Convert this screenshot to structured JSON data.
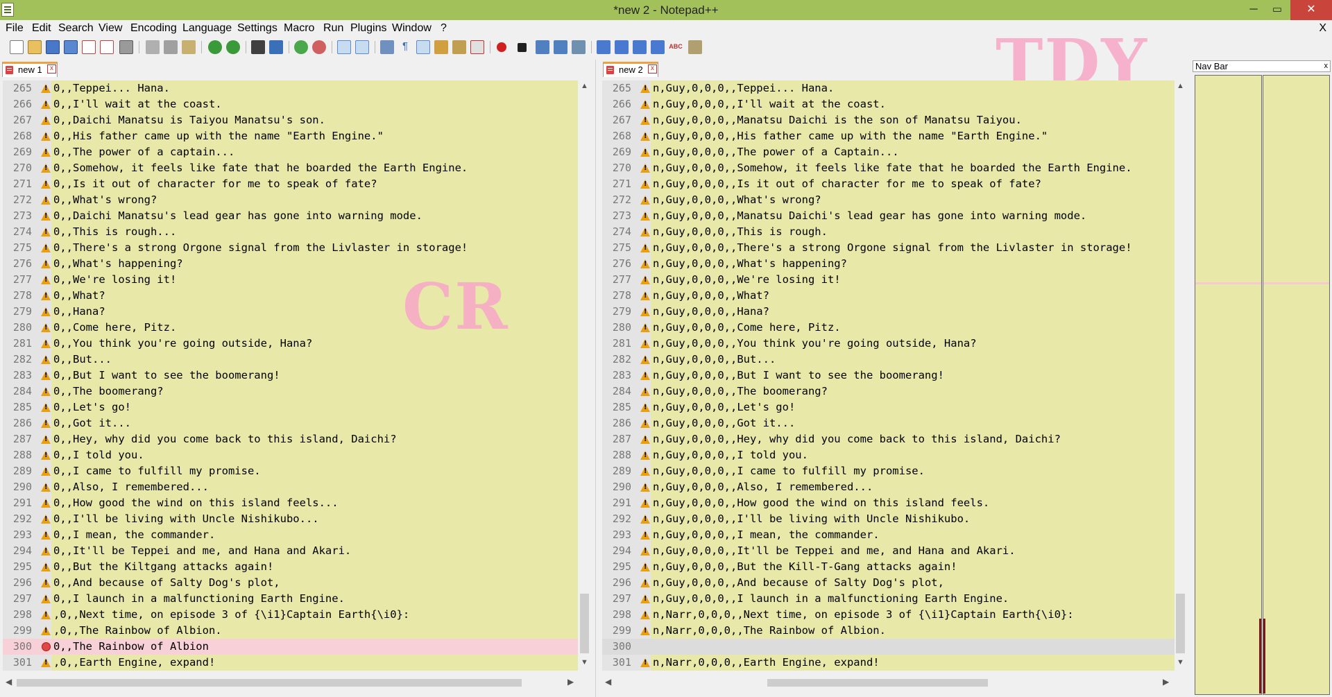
{
  "window": {
    "title": "*new  2 - Notepad++",
    "minimize": "─",
    "maximize": "▭",
    "close": "✕"
  },
  "menu": [
    "File",
    "Edit",
    "Search",
    "View",
    "Encoding",
    "Language",
    "Settings",
    "Macro",
    "Run",
    "Plugins",
    "Window",
    "?"
  ],
  "menu_close": "X",
  "watermarks": {
    "left": "CR",
    "right": "TDY"
  },
  "left_pane": {
    "tab_label": "new 1",
    "lines": [
      {
        "num": "265",
        "text": "0,,Teppei... Hana.",
        "marker": "warning"
      },
      {
        "num": "266",
        "text": "0,,I'll wait at the coast.",
        "marker": "warning"
      },
      {
        "num": "267",
        "text": "0,,Daichi Manatsu is Taiyou Manatsu's son.",
        "marker": "warning"
      },
      {
        "num": "268",
        "text": "0,,His father came up with the name \"Earth Engine.\"",
        "marker": "warning"
      },
      {
        "num": "269",
        "text": "0,,The power of a captain...",
        "marker": "warning"
      },
      {
        "num": "270",
        "text": "0,,Somehow, it feels like fate that he boarded the Earth Engine.",
        "marker": "warning"
      },
      {
        "num": "271",
        "text": "0,,Is it out of character for me to speak of fate?",
        "marker": "warning"
      },
      {
        "num": "272",
        "text": "0,,What's wrong?",
        "marker": "warning"
      },
      {
        "num": "273",
        "text": "0,,Daichi Manatsu's lead gear has gone into warning mode.",
        "marker": "warning"
      },
      {
        "num": "274",
        "text": "0,,This is rough...",
        "marker": "warning"
      },
      {
        "num": "275",
        "text": "0,,There's a strong Orgone signal from the Livlaster in storage!",
        "marker": "warning"
      },
      {
        "num": "276",
        "text": "0,,What's happening?",
        "marker": "warning"
      },
      {
        "num": "277",
        "text": "0,,We're losing it!",
        "marker": "warning"
      },
      {
        "num": "278",
        "text": "0,,What?",
        "marker": "warning"
      },
      {
        "num": "279",
        "text": "0,,Hana?",
        "marker": "warning"
      },
      {
        "num": "280",
        "text": "0,,Come here, Pitz.",
        "marker": "warning"
      },
      {
        "num": "281",
        "text": "0,,You think you're going outside, Hana?",
        "marker": "warning"
      },
      {
        "num": "282",
        "text": "0,,But...",
        "marker": "warning"
      },
      {
        "num": "283",
        "text": "0,,But I want to see the boomerang!",
        "marker": "warning"
      },
      {
        "num": "284",
        "text": "0,,The boomerang?",
        "marker": "warning"
      },
      {
        "num": "285",
        "text": "0,,Let's go!",
        "marker": "warning"
      },
      {
        "num": "286",
        "text": "0,,Got it...",
        "marker": "warning"
      },
      {
        "num": "287",
        "text": "0,,Hey, why did you come back to this island, Daichi?",
        "marker": "warning"
      },
      {
        "num": "288",
        "text": "0,,I told you.",
        "marker": "warning"
      },
      {
        "num": "289",
        "text": "0,,I came to fulfill my promise.",
        "marker": "warning"
      },
      {
        "num": "290",
        "text": "0,,Also, I remembered...",
        "marker": "warning"
      },
      {
        "num": "291",
        "text": "0,,How good the wind on this island feels...",
        "marker": "warning"
      },
      {
        "num": "292",
        "text": "0,,I'll be living with Uncle Nishikubo...",
        "marker": "warning"
      },
      {
        "num": "293",
        "text": "0,,I mean, the commander.",
        "marker": "warning"
      },
      {
        "num": "294",
        "text": "0,,It'll be Teppei and me, and Hana and Akari.",
        "marker": "warning"
      },
      {
        "num": "295",
        "text": "0,,But the Kiltgang attacks again!",
        "marker": "warning"
      },
      {
        "num": "296",
        "text": "0,,And because of Salty Dog's plot,",
        "marker": "warning"
      },
      {
        "num": "297",
        "text": "0,,I launch in a malfunctioning Earth Engine.",
        "marker": "warning"
      },
      {
        "num": "298",
        "text": ",0,,Next time, on episode 3 of {\\i1}Captain Earth{\\i0}:",
        "marker": "warning"
      },
      {
        "num": "299",
        "text": ",0,,The Rainbow of Albion.",
        "marker": "warning"
      },
      {
        "num": "300",
        "text": "0,,The Rainbow of Albion",
        "marker": "removed"
      },
      {
        "num": "301",
        "text": ",0,,Earth Engine, expand!",
        "marker": "warning"
      }
    ]
  },
  "right_pane": {
    "tab_label": "new 2",
    "lines": [
      {
        "num": "265",
        "text": "n,Guy,0,0,0,,Teppei... Hana.",
        "marker": "warning"
      },
      {
        "num": "266",
        "text": "n,Guy,0,0,0,,I'll wait at the coast.",
        "marker": "warning"
      },
      {
        "num": "267",
        "text": "n,Guy,0,0,0,,Manatsu Daichi is the son of Manatsu Taiyou.",
        "marker": "warning"
      },
      {
        "num": "268",
        "text": "n,Guy,0,0,0,,His father came up with the name \"Earth Engine.\"",
        "marker": "warning"
      },
      {
        "num": "269",
        "text": "n,Guy,0,0,0,,The power of a Captain...",
        "marker": "warning"
      },
      {
        "num": "270",
        "text": "n,Guy,0,0,0,,Somehow, it feels like fate that he boarded the Earth Engine.",
        "marker": "warning"
      },
      {
        "num": "271",
        "text": "n,Guy,0,0,0,,Is it out of character for me to speak of fate?",
        "marker": "warning"
      },
      {
        "num": "272",
        "text": "n,Guy,0,0,0,,What's wrong?",
        "marker": "warning"
      },
      {
        "num": "273",
        "text": "n,Guy,0,0,0,,Manatsu Daichi's lead gear has gone into warning mode.",
        "marker": "warning"
      },
      {
        "num": "274",
        "text": "n,Guy,0,0,0,,This is rough.",
        "marker": "warning"
      },
      {
        "num": "275",
        "text": "n,Guy,0,0,0,,There's a strong Orgone signal from the Livlaster in storage!",
        "marker": "warning"
      },
      {
        "num": "276",
        "text": "n,Guy,0,0,0,,What's happening?",
        "marker": "warning"
      },
      {
        "num": "277",
        "text": "n,Guy,0,0,0,,We're losing it!",
        "marker": "warning"
      },
      {
        "num": "278",
        "text": "n,Guy,0,0,0,,What?",
        "marker": "warning"
      },
      {
        "num": "279",
        "text": "n,Guy,0,0,0,,Hana?",
        "marker": "warning"
      },
      {
        "num": "280",
        "text": "n,Guy,0,0,0,,Come here, Pitz.",
        "marker": "warning"
      },
      {
        "num": "281",
        "text": "n,Guy,0,0,0,,You think you're going outside, Hana?",
        "marker": "warning"
      },
      {
        "num": "282",
        "text": "n,Guy,0,0,0,,But...",
        "marker": "warning"
      },
      {
        "num": "283",
        "text": "n,Guy,0,0,0,,But I want to see the boomerang!",
        "marker": "warning"
      },
      {
        "num": "284",
        "text": "n,Guy,0,0,0,,The boomerang?",
        "marker": "warning"
      },
      {
        "num": "285",
        "text": "n,Guy,0,0,0,,Let's go!",
        "marker": "warning"
      },
      {
        "num": "286",
        "text": "n,Guy,0,0,0,,Got it...",
        "marker": "warning"
      },
      {
        "num": "287",
        "text": "n,Guy,0,0,0,,Hey, why did you come back to this island, Daichi?",
        "marker": "warning"
      },
      {
        "num": "288",
        "text": "n,Guy,0,0,0,,I told you.",
        "marker": "warning"
      },
      {
        "num": "289",
        "text": "n,Guy,0,0,0,,I came to fulfill my promise.",
        "marker": "warning"
      },
      {
        "num": "290",
        "text": "n,Guy,0,0,0,,Also, I remembered...",
        "marker": "warning"
      },
      {
        "num": "291",
        "text": "n,Guy,0,0,0,,How good the wind on this island feels.",
        "marker": "warning"
      },
      {
        "num": "292",
        "text": "n,Guy,0,0,0,,I'll be living with Uncle Nishikubo.",
        "marker": "warning"
      },
      {
        "num": "293",
        "text": "n,Guy,0,0,0,,I mean, the commander.",
        "marker": "warning"
      },
      {
        "num": "294",
        "text": "n,Guy,0,0,0,,It'll be Teppei and me, and Hana and Akari.",
        "marker": "warning"
      },
      {
        "num": "295",
        "text": "n,Guy,0,0,0,,But the Kill-T-Gang attacks again!",
        "marker": "warning"
      },
      {
        "num": "296",
        "text": "n,Guy,0,0,0,,And because of Salty Dog's plot,",
        "marker": "warning"
      },
      {
        "num": "297",
        "text": "n,Guy,0,0,0,,I launch in a malfunctioning Earth Engine.",
        "marker": "warning"
      },
      {
        "num": "298",
        "text": "n,Narr,0,0,0,,Next time, on episode 3 of {\\i1}Captain Earth{\\i0}:",
        "marker": "warning"
      },
      {
        "num": "299",
        "text": "n,Narr,0,0,0,,The Rainbow of Albion.",
        "marker": "warning"
      },
      {
        "num": "300",
        "text": "",
        "marker": "empty"
      },
      {
        "num": "301",
        "text": "n,Narr,0,0,0,,Earth Engine, expand!",
        "marker": "warning"
      }
    ]
  },
  "nav_bar": {
    "title": "Nav Bar",
    "close": "x"
  }
}
